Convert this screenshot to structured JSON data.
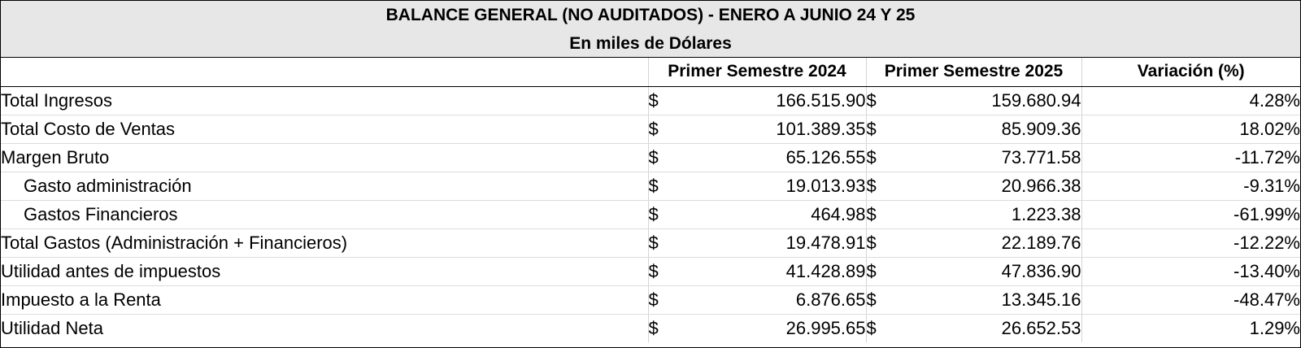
{
  "title": "BALANCE GENERAL (NO AUDITADOS) - ENERO A JUNIO 24 Y 25",
  "subtitle": "En miles de Dólares",
  "currency_symbol": "$",
  "columns": [
    "",
    "Primer Semestre 2024",
    "Primer Semestre 2025",
    "Variación (%)"
  ],
  "rows": [
    {
      "label": "Total Ingresos",
      "indent": false,
      "y2024": "166.515.90",
      "y2025": "159.680.94",
      "variation": "4.28%"
    },
    {
      "label": "Total Costo de Ventas",
      "indent": false,
      "y2024": "101.389.35",
      "y2025": "85.909.36",
      "variation": "18.02%"
    },
    {
      "label": "Margen Bruto",
      "indent": false,
      "y2024": "65.126.55",
      "y2025": "73.771.58",
      "variation": "-11.72%"
    },
    {
      "label": "Gasto administración",
      "indent": true,
      "y2024": "19.013.93",
      "y2025": "20.966.38",
      "variation": "-9.31%"
    },
    {
      "label": "Gastos Financieros",
      "indent": true,
      "y2024": "464.98",
      "y2025": "1.223.38",
      "variation": "-61.99%"
    },
    {
      "label": "Total Gastos (Administración + Financieros)",
      "indent": false,
      "y2024": "19.478.91",
      "y2025": "22.189.76",
      "variation": "-12.22%"
    },
    {
      "label": "Utilidad antes de impuestos",
      "indent": false,
      "y2024": "41.428.89",
      "y2025": "47.836.90",
      "variation": "-13.40%"
    },
    {
      "label": "Impuesto a la Renta",
      "indent": false,
      "y2024": "6.876.65",
      "y2025": "13.345.16",
      "variation": "-48.47%"
    },
    {
      "label": "Utilidad Neta",
      "indent": false,
      "y2024": "26.995.65",
      "y2025": "26.652.53",
      "variation": "1.29%"
    }
  ],
  "colors": {
    "title_background": "#e7e7e7",
    "border": "#000000",
    "gridline": "#dcdcdc"
  }
}
